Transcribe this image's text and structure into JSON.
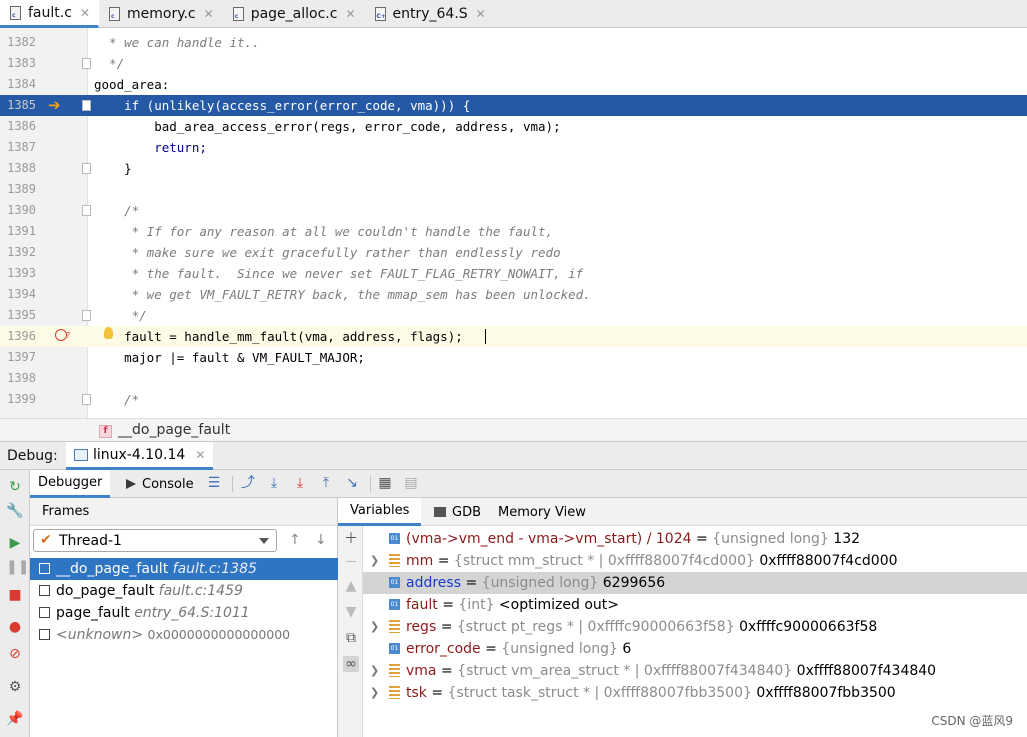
{
  "editor_tabs": [
    {
      "label": "fault.c",
      "icon": "c-file-icon",
      "active": true
    },
    {
      "label": "memory.c",
      "icon": "c-file-icon",
      "active": false
    },
    {
      "label": "page_alloc.c",
      "icon": "c-file-icon",
      "active": false
    },
    {
      "label": "entry_64.S",
      "icon": "asm-file-icon",
      "active": false
    }
  ],
  "code_lines": [
    {
      "num": "1382",
      "text": "  * we can handle it..",
      "style": "comment"
    },
    {
      "num": "1383",
      "text": "  */",
      "style": "comment"
    },
    {
      "num": "1384",
      "text": "good_area:",
      "style": "plain"
    },
    {
      "num": "1385",
      "text": "    if (unlikely(access_error(error_code, vma))) {",
      "style": "exec"
    },
    {
      "num": "1386",
      "text": "        bad_area_access_error(regs, error_code, address, vma);",
      "style": "plain"
    },
    {
      "num": "1387",
      "text": "        return;",
      "style": "kw"
    },
    {
      "num": "1388",
      "text": "    }",
      "style": "plain"
    },
    {
      "num": "1389",
      "text": "",
      "style": "plain"
    },
    {
      "num": "1390",
      "text": "    /*",
      "style": "comment"
    },
    {
      "num": "1391",
      "text": "     * If for any reason at all we couldn't handle the fault,",
      "style": "comment"
    },
    {
      "num": "1392",
      "text": "     * make sure we exit gracefully rather than endlessly redo",
      "style": "comment"
    },
    {
      "num": "1393",
      "text": "     * the fault.  Since we never set FAULT_FLAG_RETRY_NOWAIT, if",
      "style": "comment"
    },
    {
      "num": "1394",
      "text": "     * we get VM_FAULT_RETRY back, the mmap_sem has been unlocked.",
      "style": "comment"
    },
    {
      "num": "1395",
      "text": "     */",
      "style": "comment"
    },
    {
      "num": "1396",
      "text": "    fault = handle_mm_fault(vma, address, flags);",
      "style": "current"
    },
    {
      "num": "1397",
      "text": "    major |= fault & VM_FAULT_MAJOR;",
      "style": "plain"
    },
    {
      "num": "1398",
      "text": "",
      "style": "plain"
    },
    {
      "num": "1399",
      "text": "    /*",
      "style": "comment"
    }
  ],
  "breadcrumb": {
    "badge": "f",
    "function": "__do_page_fault"
  },
  "debug": {
    "label": "Debug:",
    "session_tab": "linux-4.10.14",
    "tabs": {
      "debugger": "Debugger",
      "console": "Console"
    }
  },
  "frames": {
    "header": "Frames",
    "thread": "Thread-1",
    "items": [
      {
        "fn": "__do_page_fault",
        "loc": "fault.c:1385",
        "selected": true
      },
      {
        "fn": "do_page_fault",
        "loc": "fault.c:1459",
        "selected": false
      },
      {
        "fn": "page_fault",
        "loc": "entry_64.S:1011",
        "selected": false
      },
      {
        "fn": "<unknown>",
        "loc": "0x0000000000000000",
        "selected": false
      }
    ]
  },
  "variables": {
    "tabs": {
      "variables": "Variables",
      "gdb": "GDB",
      "memory": "Memory View"
    },
    "items": [
      {
        "name": "(vma->vm_end - vma->vm_start) / 1024",
        "eq": " = ",
        "type": "{unsigned long}",
        "value": " 132",
        "kind": "primitive",
        "expandable": false
      },
      {
        "name": "mm",
        "eq": " = ",
        "type": "{struct mm_struct * | 0xffff88007f4cd000}",
        "value": " 0xffff88007f4cd000",
        "kind": "struct",
        "expandable": true
      },
      {
        "name": "address",
        "eq": " = ",
        "type": "{unsigned long}",
        "value": " 6299656",
        "kind": "primitive",
        "expandable": false
      },
      {
        "name": "fault",
        "eq": " = ",
        "type": "{int}",
        "value": " <optimized out>",
        "kind": "primitive",
        "expandable": false
      },
      {
        "name": "regs",
        "eq": " = ",
        "type": "{struct pt_regs * | 0xffffc90000663f58}",
        "value": " 0xffffc90000663f58",
        "kind": "struct",
        "expandable": true
      },
      {
        "name": "error_code",
        "eq": " = ",
        "type": "{unsigned long}",
        "value": " 6",
        "kind": "primitive",
        "expandable": false
      },
      {
        "name": "vma",
        "eq": " = ",
        "type": "{struct vm_area_struct * | 0xffff88007f434840}",
        "value": " 0xffff88007f434840",
        "kind": "struct",
        "expandable": true
      },
      {
        "name": "tsk",
        "eq": " = ",
        "type": "{struct task_struct * | 0xffff88007fbb3500}",
        "value": " 0xffff88007fbb3500",
        "kind": "struct",
        "expandable": true
      }
    ]
  },
  "watermark": "CSDN @蓝风9",
  "colors": {
    "accent": "#4083c9",
    "exec_line": "#2559a6",
    "selection": "#2e75c3"
  }
}
